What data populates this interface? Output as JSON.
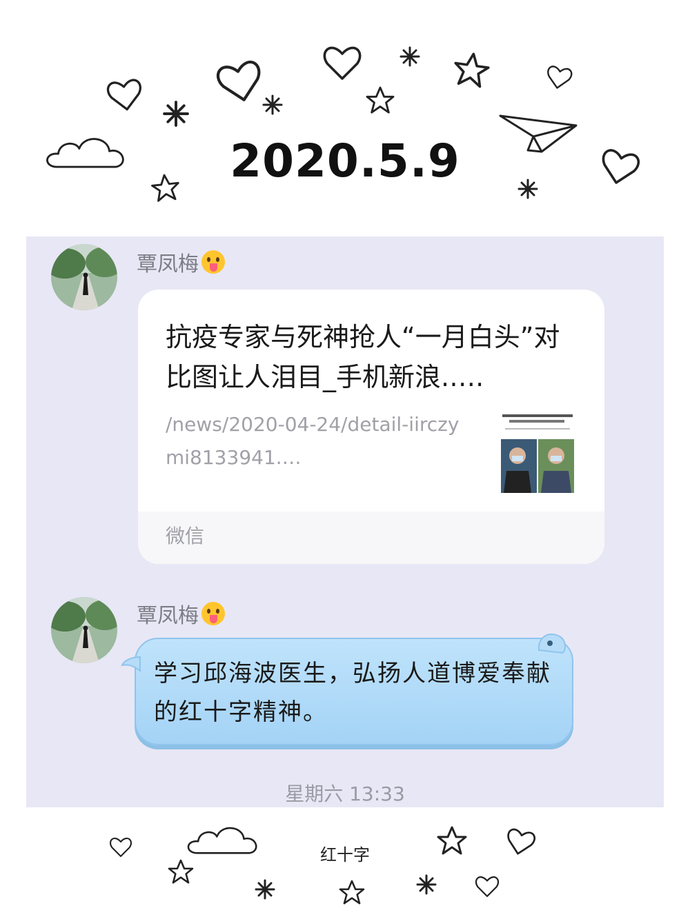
{
  "header": {
    "date": "2020.5.9"
  },
  "messages": [
    {
      "sender": "覃凤梅"
    },
    {
      "sender": "覃凤梅",
      "text": "学习邱海波医生，弘扬人道博爱奉献的红十字精神。"
    }
  ],
  "link_card": {
    "title": "抗疫专家与死神抢人“一月白头”对比图让人泪目_手机新浪.….",
    "description": "/news/2020-04-24/detail-iirczymi8133941.…",
    "source": "微信"
  },
  "timestamp": "星期六 13:33",
  "caption": "红十字",
  "icons": [
    "heart-icon",
    "star-icon",
    "sparkle-icon",
    "cloud-icon",
    "paper-plane-icon",
    "tongue-emoji-icon",
    "avatar"
  ],
  "colors": {
    "panel": "#e8e7f5",
    "bubble": "#a4d3f6",
    "card": "#ffffff"
  }
}
